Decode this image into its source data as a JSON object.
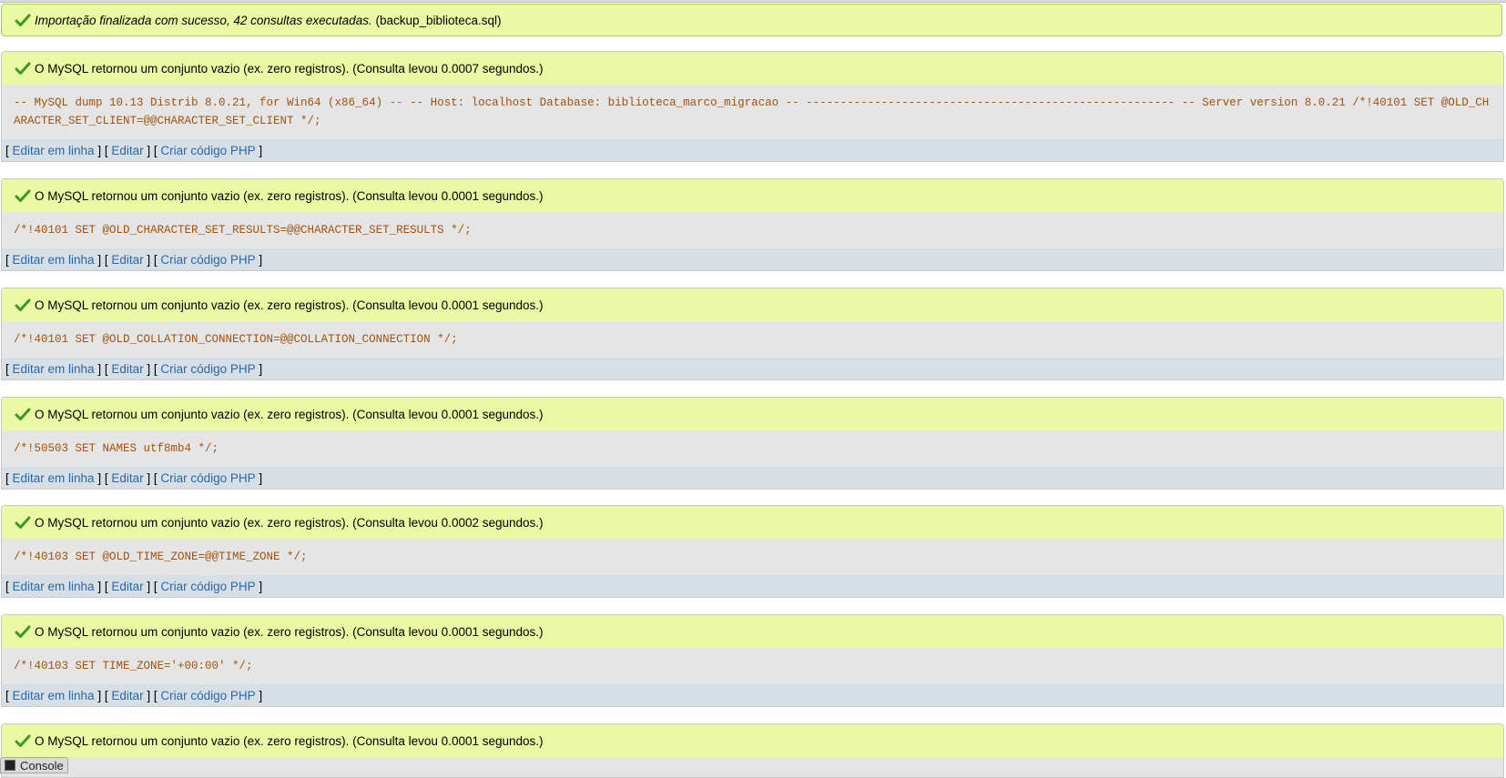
{
  "import_banner": {
    "text": "Importação finalizada com sucesso, 42 consultas executadas.",
    "file": "(backup_biblioteca.sql)"
  },
  "colors": {
    "success_bg": "#ebf8a4",
    "success_border": "#a2d246",
    "sql_text": "#a0520e",
    "link": "#2a67a8"
  },
  "icons": {
    "check": "check-icon",
    "console": "console-icon"
  },
  "links": {
    "inline": "Editar em linha",
    "edit": "Editar",
    "php": "Criar código PHP"
  },
  "queries": [
    {
      "result": "O MySQL retornou um conjunto vazio (ex. zero registros). (Consulta levou 0.0007 segundos.)",
      "sql_a": "-- MySQL dump 10.13 Distrib 8.0.21, for Win64 (x86_64)",
      "sql_b": " -- ",
      "sql_c": "-- Host: localhost Database: biblioteca_marco_migracao -- ------------------------------------------------------ -- Server version 8.0.21 /*!40101 SET @OLD_CHARACTER_SET_CLIENT=@@CHARACTER_SET_CLIENT */;"
    },
    {
      "result": "O MySQL retornou um conjunto vazio (ex. zero registros). (Consulta levou 0.0001 segundos.)",
      "sql": "/*!40101 SET @OLD_CHARACTER_SET_RESULTS=@@CHARACTER_SET_RESULTS */;"
    },
    {
      "result": "O MySQL retornou um conjunto vazio (ex. zero registros). (Consulta levou 0.0001 segundos.)",
      "sql": "/*!40101 SET @OLD_COLLATION_CONNECTION=@@COLLATION_CONNECTION */;"
    },
    {
      "result": "O MySQL retornou um conjunto vazio (ex. zero registros). (Consulta levou 0.0001 segundos.)",
      "sql": "/*!50503 SET NAMES utf8mb4 */;"
    },
    {
      "result": "O MySQL retornou um conjunto vazio (ex. zero registros). (Consulta levou 0.0002 segundos.)",
      "sql": "/*!40103 SET @OLD_TIME_ZONE=@@TIME_ZONE */;"
    },
    {
      "result": "O MySQL retornou um conjunto vazio (ex. zero registros). (Consulta levou 0.0001 segundos.)",
      "sql": "/*!40103 SET TIME_ZONE='+00:00' */;"
    },
    {
      "result": "O MySQL retornou um conjunto vazio (ex. zero registros). (Consulta levou 0.0001 segundos.)"
    }
  ],
  "console": {
    "label": "Console"
  }
}
